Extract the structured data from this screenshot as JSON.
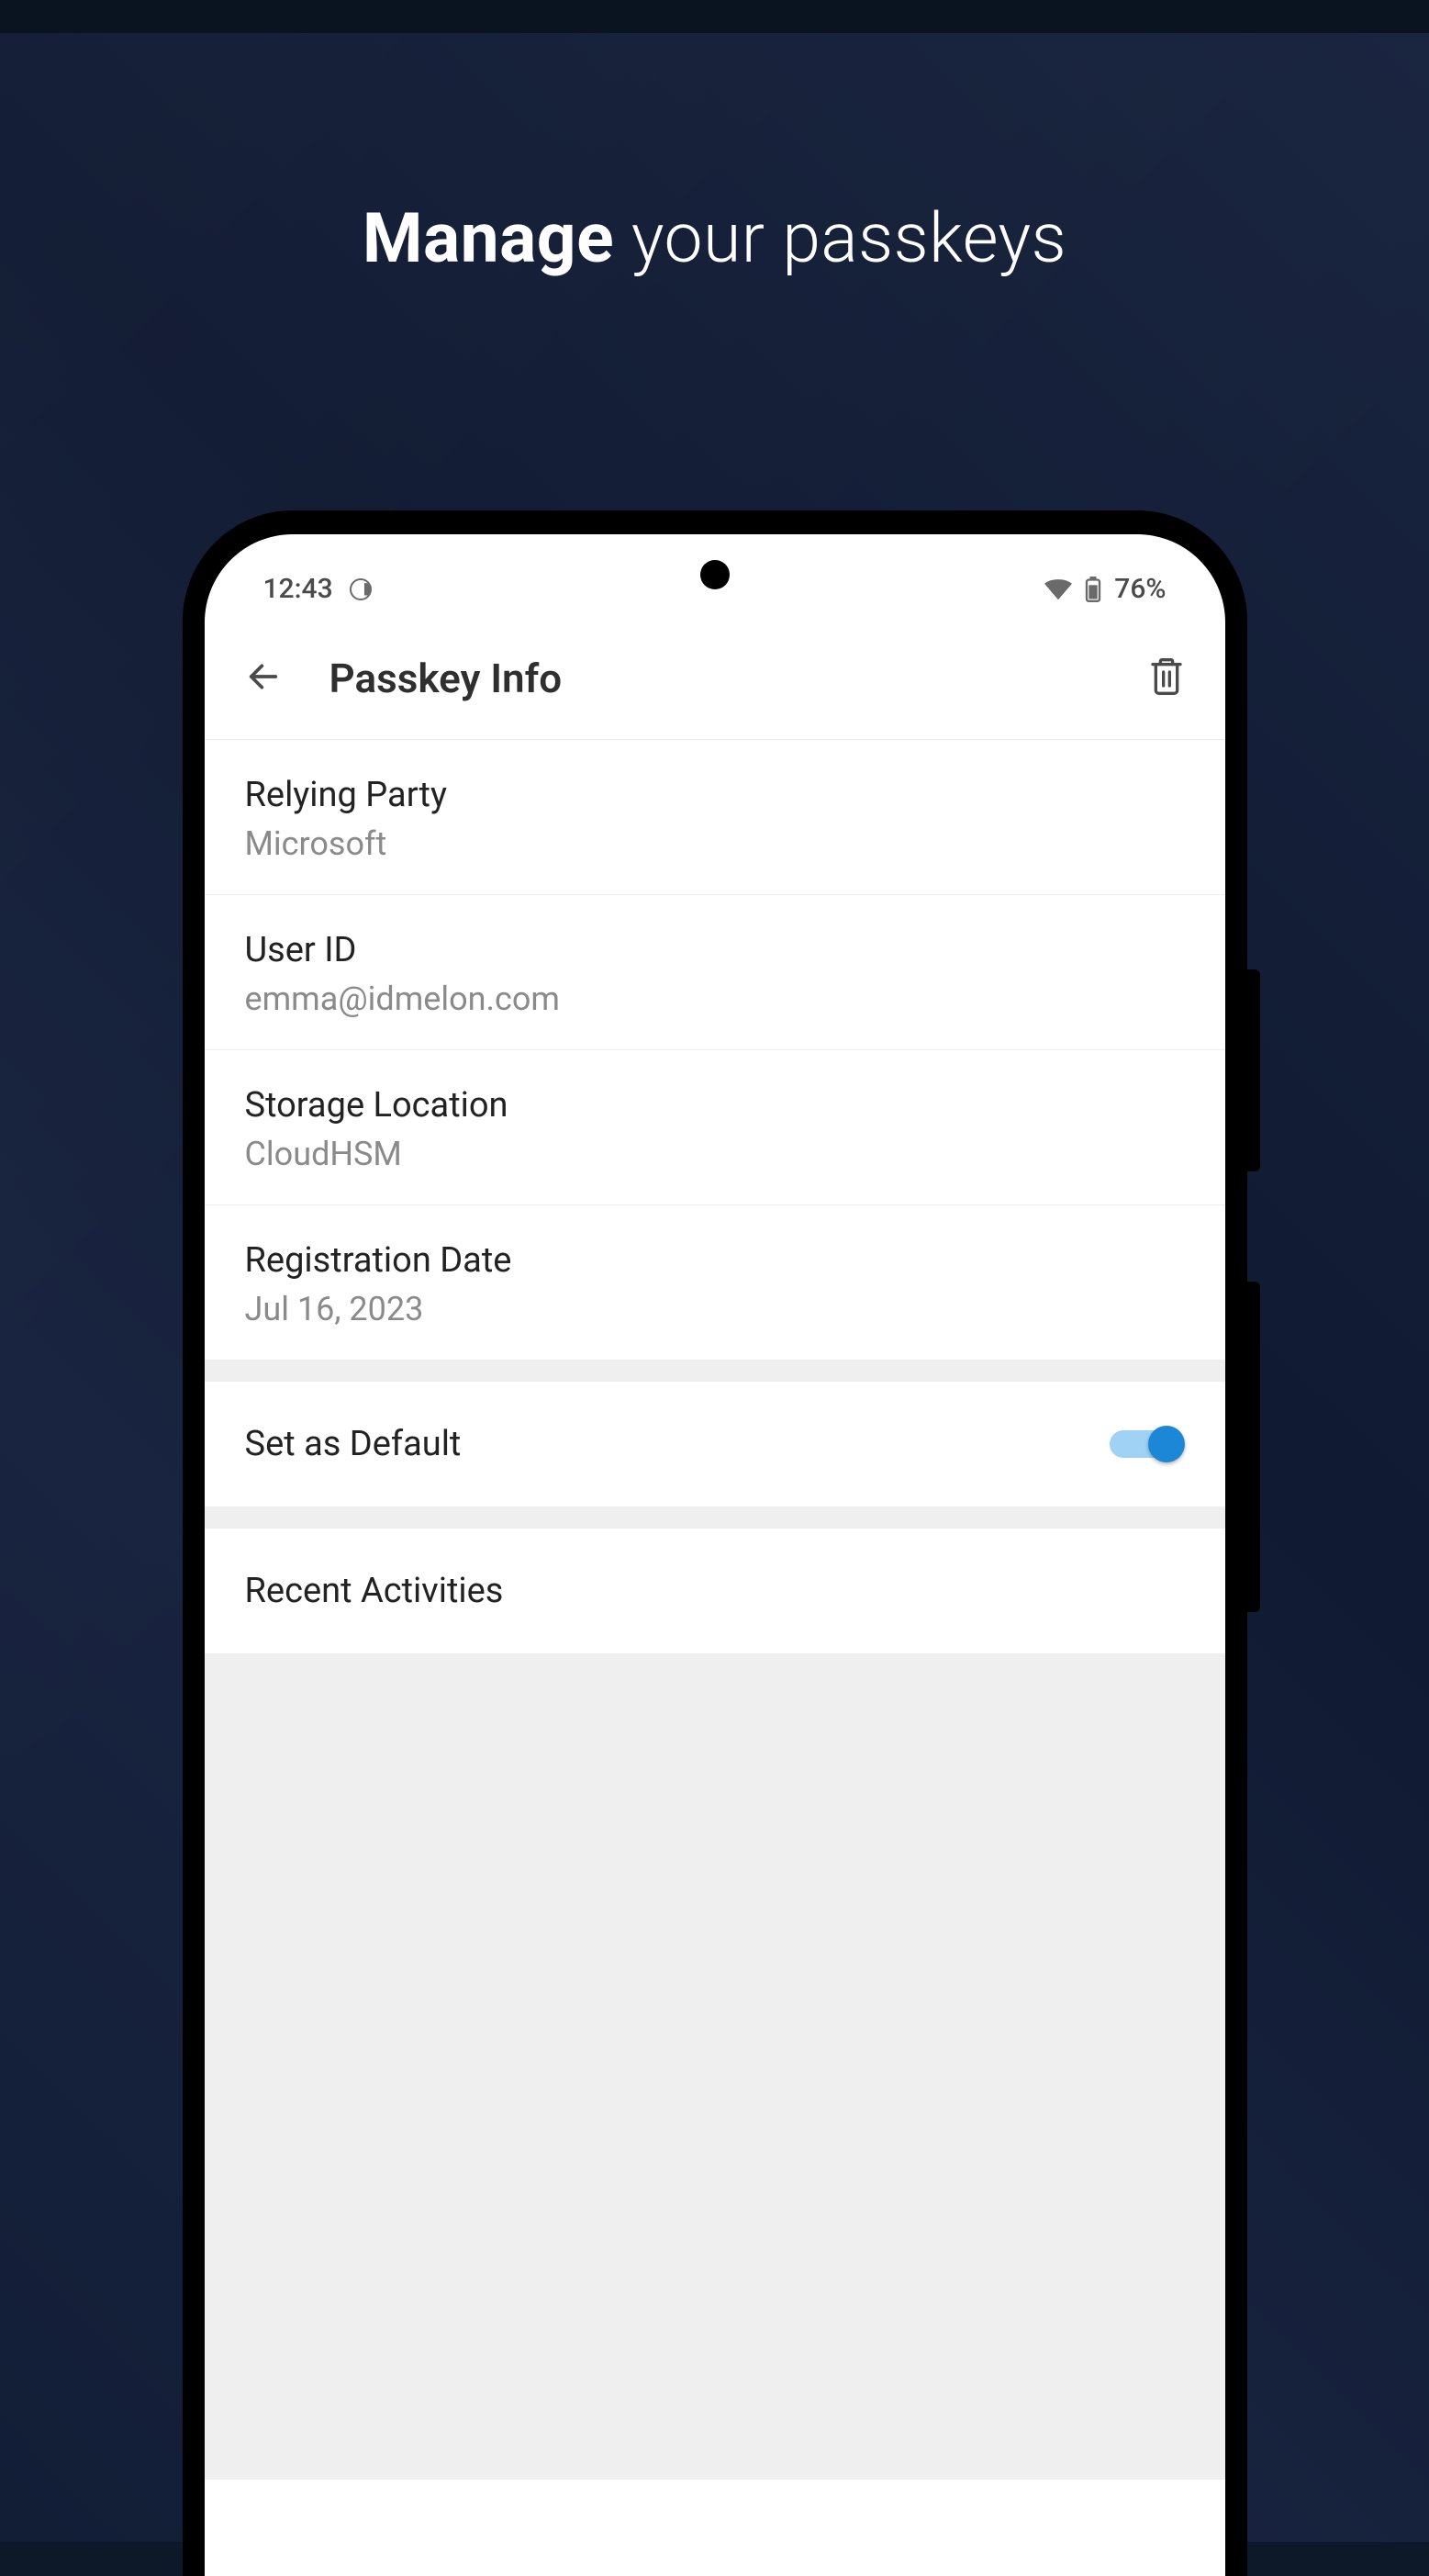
{
  "headline": {
    "bold": "Manage",
    "rest": " your passkeys"
  },
  "status": {
    "time": "12:43",
    "battery_pct": "76%"
  },
  "header": {
    "title": "Passkey Info"
  },
  "info": {
    "relying_party_label": "Relying Party",
    "relying_party_value": "Microsoft",
    "user_id_label": "User ID",
    "user_id_value": "emma@idmelon.com",
    "storage_label": "Storage Location",
    "storage_value": "CloudHSM",
    "reg_date_label": "Registration Date",
    "reg_date_value": "Jul 16, 2023"
  },
  "default_toggle": {
    "label": "Set as Default",
    "on": true
  },
  "recent": {
    "label": "Recent Activities"
  }
}
